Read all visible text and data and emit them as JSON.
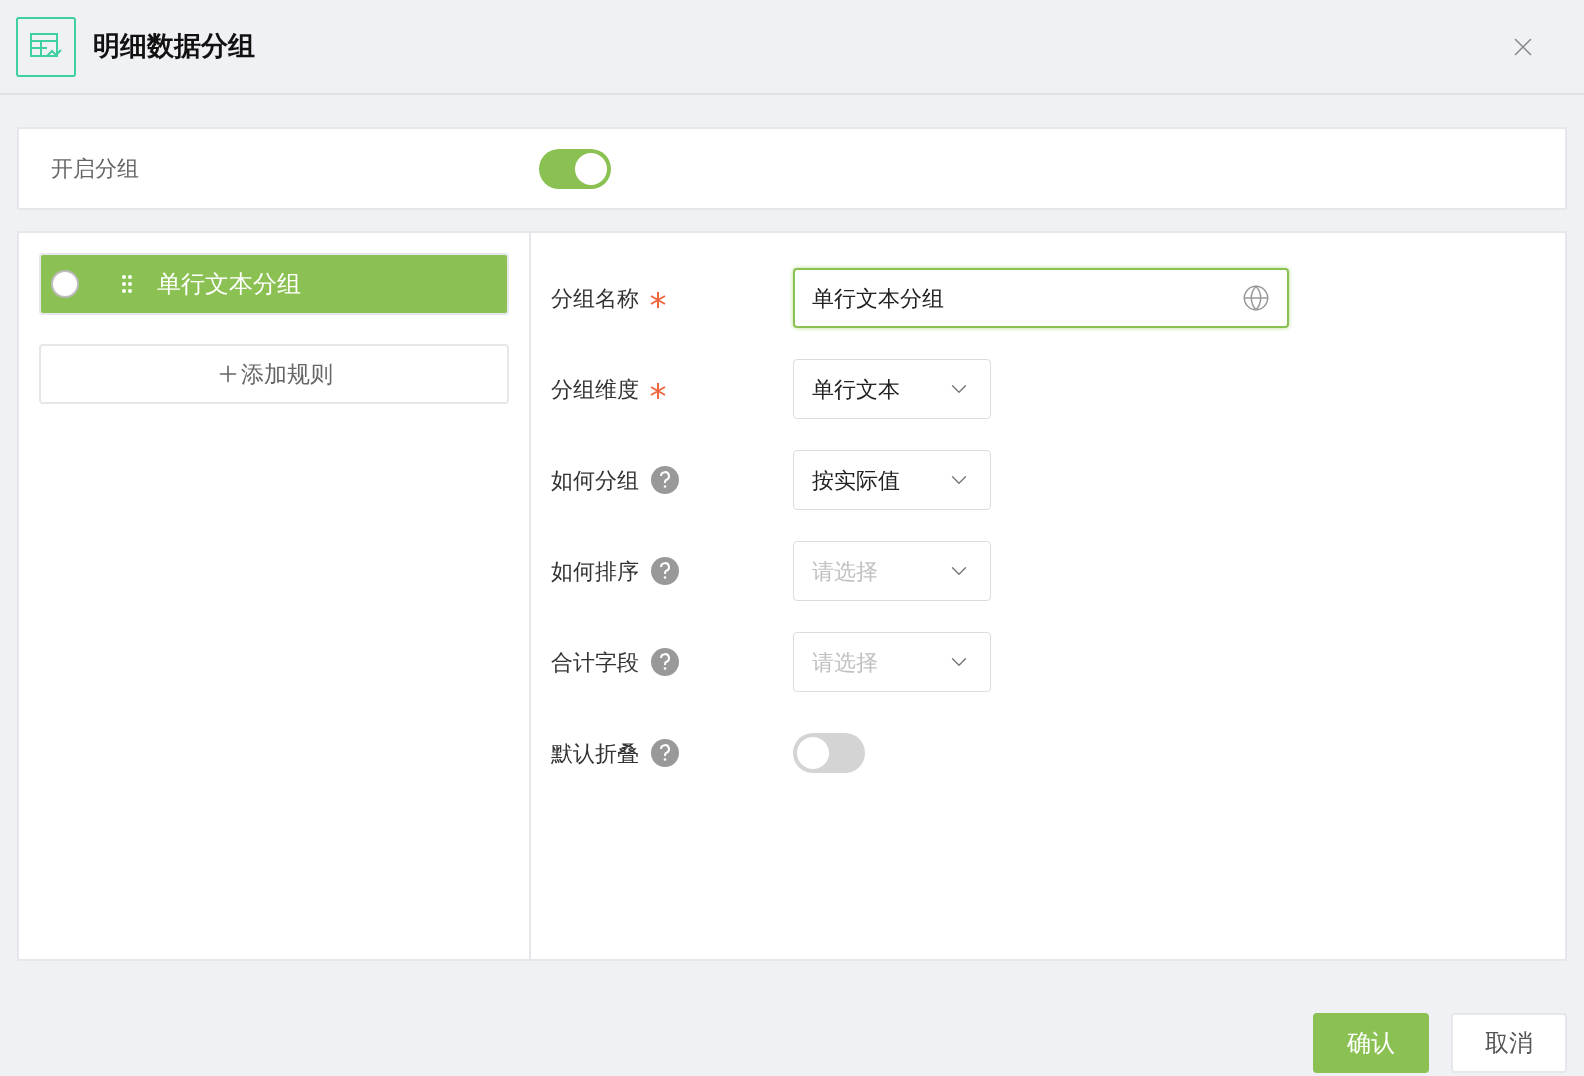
{
  "dialog": {
    "title": "明细数据分组"
  },
  "enable_grouping": {
    "label": "开启分组",
    "on": true
  },
  "rules": [
    {
      "label": "单行文本分组",
      "selected": true
    }
  ],
  "add_rule_button": {
    "label": "添加规则"
  },
  "fields": [
    {
      "label": "分组名称",
      "required": true,
      "help": false,
      "kind": "text",
      "value": "单行文本分组"
    },
    {
      "label": "分组维度",
      "required": true,
      "help": false,
      "kind": "select",
      "value": "单行文本"
    },
    {
      "label": "如何分组",
      "required": false,
      "help": true,
      "kind": "select",
      "value": "按实际值"
    },
    {
      "label": "如何排序",
      "required": false,
      "help": true,
      "kind": "select",
      "placeholder": "请选择"
    },
    {
      "label": "合计字段",
      "required": false,
      "help": true,
      "kind": "select",
      "placeholder": "请选择"
    },
    {
      "label": "默认折叠",
      "required": false,
      "help": true,
      "kind": "toggle",
      "on": false
    }
  ],
  "buttons": [
    {
      "label": "确认",
      "kind": "primary"
    },
    {
      "label": "取消",
      "kind": "default"
    }
  ]
}
